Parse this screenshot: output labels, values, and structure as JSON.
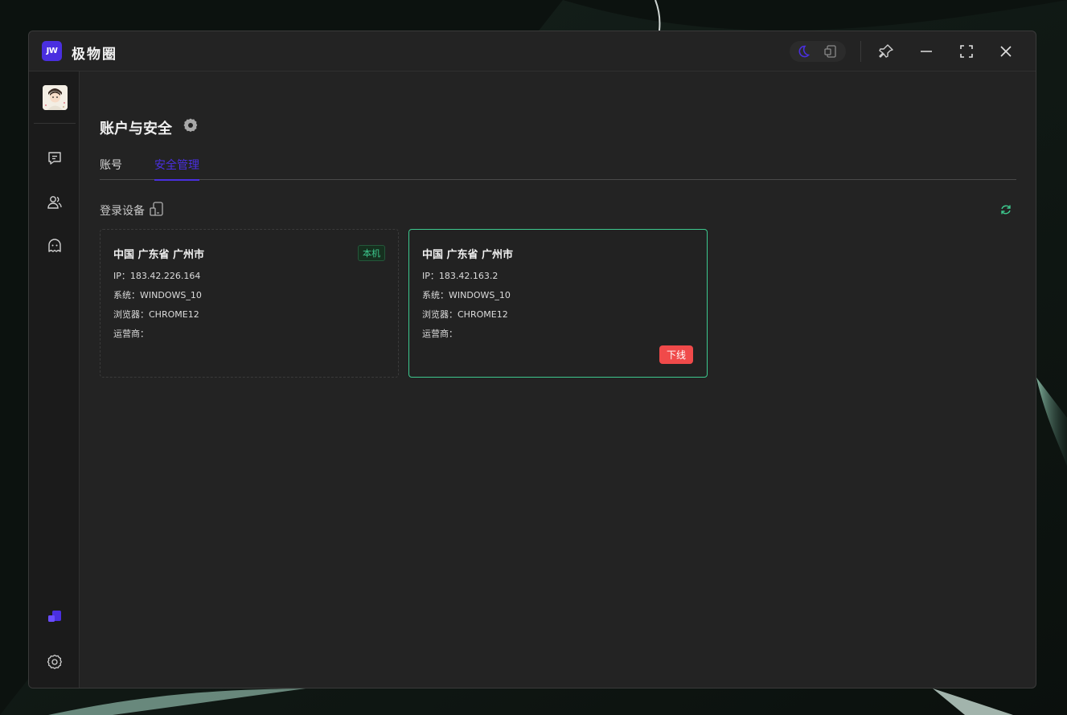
{
  "app": {
    "logo_text": "JW",
    "title": "极物圈"
  },
  "page": {
    "title": "账户与安全",
    "tabs": [
      {
        "label": "账号",
        "active": false
      },
      {
        "label": "安全管理",
        "active": true
      }
    ],
    "section_label": "登录设备"
  },
  "devices": [
    {
      "location": "中国 广东省 广州市",
      "ip": "IP：183.42.226.164",
      "system": "系统：WINDOWS_10",
      "browser": "浏览器：CHROME12",
      "carrier": "运营商：",
      "badge": "本机"
    },
    {
      "location": "中国 广东省 广州市",
      "ip": "IP：183.42.163.2",
      "system": "系统：WINDOWS_10",
      "browser": "浏览器：CHROME12",
      "carrier": "运营商：",
      "action": "下线"
    }
  ],
  "colors": {
    "accent": "#4a2fe0",
    "success": "#3dc98e",
    "danger": "#f04a4a",
    "window_bg": "#232323",
    "sidebar_bg": "#1b1b1b"
  },
  "icons": {
    "sidebar": [
      "chat-icon",
      "contacts-icon",
      "ghost-icon"
    ],
    "sidebar_bottom": [
      "layers-icon",
      "settings-icon"
    ],
    "titlebar": [
      "moon-icon",
      "device-switch-icon",
      "pin-icon",
      "minimize-icon",
      "maximize-icon",
      "close-icon"
    ]
  }
}
